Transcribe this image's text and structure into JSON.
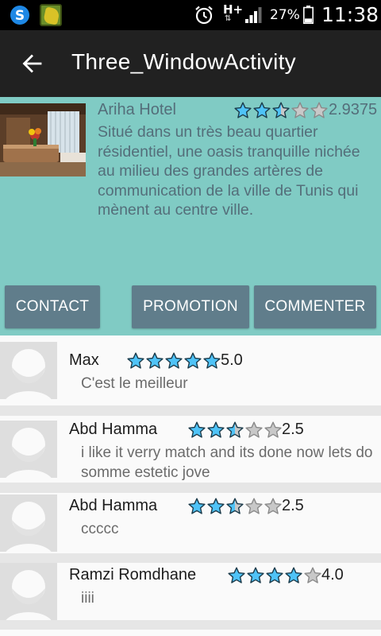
{
  "status_bar": {
    "app_icons": [
      "swiftkey-icon",
      "game-app-icon"
    ],
    "network": "H+",
    "battery_percent": "27%",
    "battery_level": 0.27,
    "signal_bars": 3,
    "time": "11:38"
  },
  "action_bar": {
    "title": "Three_WindowActivity",
    "back_icon": "arrow-back-icon"
  },
  "hotel": {
    "name": "Ariha Hotel",
    "rating": 2.9375,
    "rating_text": "2.9375",
    "description": "Situé dans un très beau quartier résidentiel, une oasis tranquille nichée au milieu des grandes artères de communication de la ville de Tunis qui mènent au centre ville."
  },
  "buttons": {
    "contact": "CONTACT",
    "promotion": "PROMOTION",
    "commenter": "COMMENTER"
  },
  "reviews": [
    {
      "name": "Max",
      "rating": 5.0,
      "rating_text": "5.0",
      "comment": "C'est le meilleur"
    },
    {
      "name": "Abd Hamma",
      "rating": 2.5,
      "rating_text": "2.5",
      "comment": "i like it verry match and its done now lets do somme estetic jove"
    },
    {
      "name": "Abd Hamma",
      "rating": 2.5,
      "rating_text": "2.5",
      "comment": "ccccc"
    },
    {
      "name": "Ramzi Romdhane",
      "rating": 4.0,
      "rating_text": "4.0",
      "comment": "iiii"
    }
  ],
  "colors": {
    "header_bg": "#80cbc4",
    "button_bg": "#607d8b",
    "star_fill": "#4fc3f7",
    "star_outline": "#1a3a4a",
    "star_empty": "#c8c8c8"
  }
}
